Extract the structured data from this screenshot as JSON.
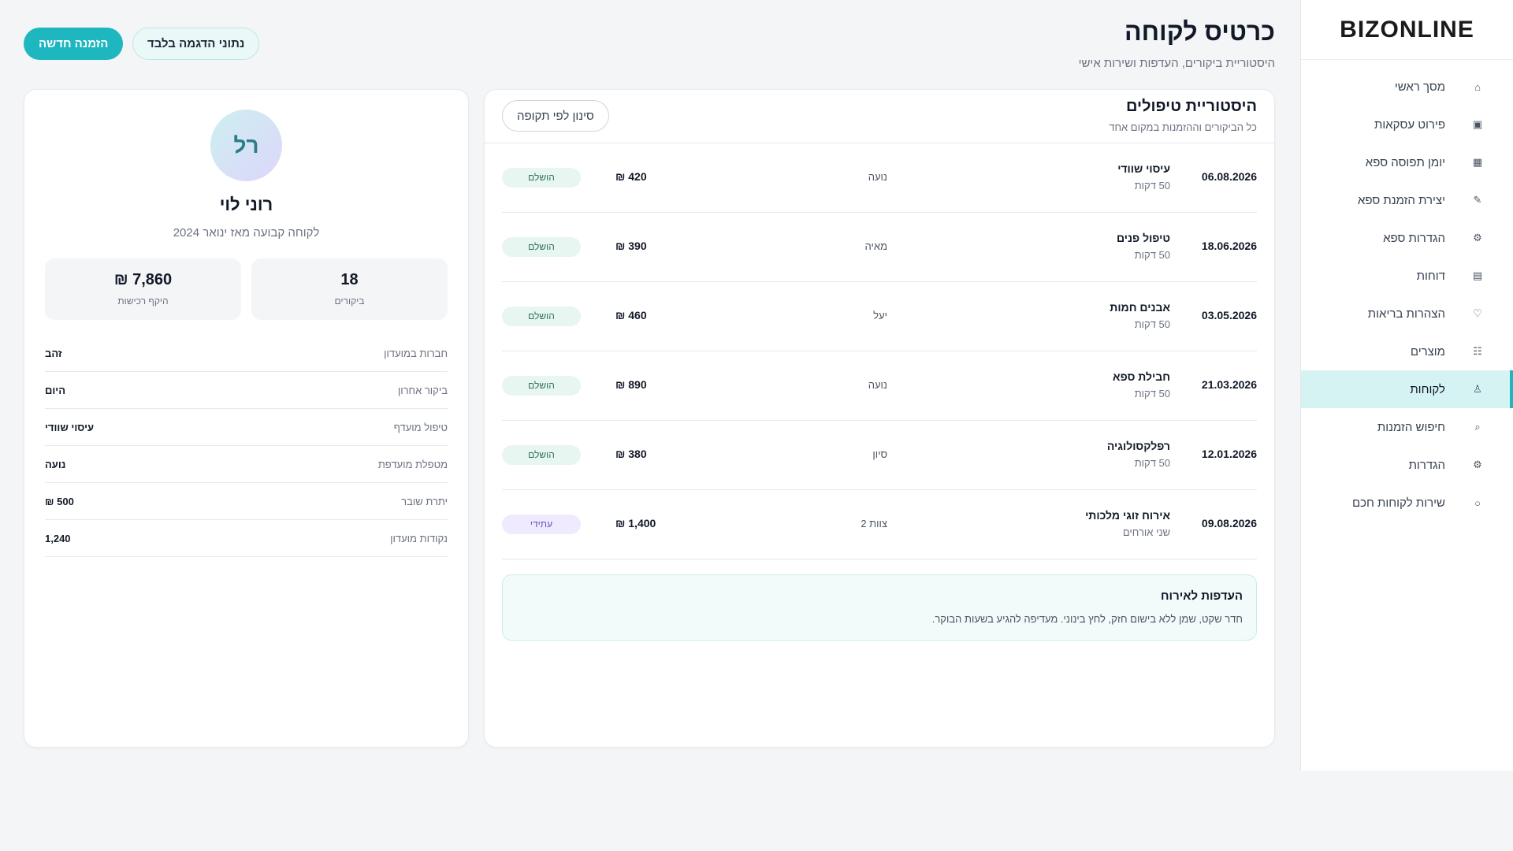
{
  "app": {
    "logo": "BIZONLINE"
  },
  "header": {
    "title": "כרטיס לקוחה",
    "subtitle": "היסטוריית ביקורים, העדפות ושירות אישי",
    "new_booking_label": "הזמנה חדשה",
    "demo_label": "נתוני הדגמה בלבד"
  },
  "sidebar": {
    "items": [
      {
        "label": "מסך ראשי",
        "icon": "home-icon",
        "glyph": "⌂"
      },
      {
        "label": "פירוט עסקאות",
        "icon": "transactions-icon",
        "glyph": "▣"
      },
      {
        "label": "יומן תפוסה ספא",
        "icon": "calendar-icon",
        "glyph": "▦"
      },
      {
        "label": "יצירת הזמנת ספא",
        "icon": "pencil-icon",
        "glyph": "✎"
      },
      {
        "label": "הגדרות ספא",
        "icon": "spa-settings-icon",
        "glyph": "⚙"
      },
      {
        "label": "דוחות",
        "icon": "reports-icon",
        "glyph": "▤"
      },
      {
        "label": "הצהרות בריאות",
        "icon": "heart-icon",
        "glyph": "♡"
      },
      {
        "label": "מוצרים",
        "icon": "products-icon",
        "glyph": "☷"
      },
      {
        "label": "לקוחות",
        "icon": "customers-icon",
        "glyph": "♙"
      },
      {
        "label": "חיפוש הזמנות",
        "icon": "search-icon",
        "glyph": "⌕"
      },
      {
        "label": "הגדרות",
        "icon": "settings-icon",
        "glyph": "⚙"
      },
      {
        "label": "שירות לקוחות חכם",
        "icon": "support-icon",
        "glyph": "○"
      }
    ],
    "active_label": "לקוחות"
  },
  "history": {
    "title": "היסטוריית טיפולים",
    "subtitle": "כל הביקורים וההזמנות במקום אחד",
    "filter_label": "סינון לפי תקופה",
    "rows": [
      {
        "date": "06.08.2026",
        "treatment": "עיסוי שוודי",
        "duration": "50 דקות",
        "therapist": "נועה",
        "price": "420 ₪",
        "status": "הושלם",
        "status_type": "done"
      },
      {
        "date": "18.06.2026",
        "treatment": "טיפול פנים",
        "duration": "50 דקות",
        "therapist": "מאיה",
        "price": "390 ₪",
        "status": "הושלם",
        "status_type": "done"
      },
      {
        "date": "03.05.2026",
        "treatment": "אבנים חמות",
        "duration": "50 דקות",
        "therapist": "יעל",
        "price": "460 ₪",
        "status": "הושלם",
        "status_type": "done"
      },
      {
        "date": "21.03.2026",
        "treatment": "חבילת ספא",
        "duration": "50 דקות",
        "therapist": "נועה",
        "price": "890 ₪",
        "status": "הושלם",
        "status_type": "done"
      },
      {
        "date": "12.01.2026",
        "treatment": "רפלקסולוגיה",
        "duration": "50 דקות",
        "therapist": "סיון",
        "price": "380 ₪",
        "status": "הושלם",
        "status_type": "done"
      },
      {
        "date": "09.08.2026",
        "treatment": "אירוח זוגי מלכותי",
        "duration": "שני אורחים",
        "therapist": "צוות 2",
        "price": "1,400 ₪",
        "status": "עתידי",
        "status_type": "future"
      }
    ],
    "prefs_title": "העדפות לאירוח",
    "prefs_text": "חדר שקט, שמן ללא בישום חזק, לחץ בינוני. מעדיפה להגיע בשעות הבוקר."
  },
  "profile": {
    "initials": "רל",
    "name": "רוני לוי",
    "since": "לקוחה קבועה מאז ינואר 2024",
    "visits_value": "18",
    "visits_label": "ביקורים",
    "spend_value": "7,860 ₪",
    "spend_label": "היקף רכישות",
    "details": [
      {
        "label": "חברות במועדון",
        "value": "זהב"
      },
      {
        "label": "ביקור אחרון",
        "value": "היום"
      },
      {
        "label": "טיפול מועדף",
        "value": "עיסוי שוודי"
      },
      {
        "label": "מטפלת מועדפת",
        "value": "נועה"
      },
      {
        "label": "יתרת שובר",
        "value": "500 ₪"
      },
      {
        "label": "נקודות מועדון",
        "value": "1,240"
      }
    ]
  },
  "colors": {
    "accent": "#1eb7bf",
    "active_nav_bg": "#d6f3f3",
    "done_badge_bg": "#e7f6f1",
    "future_badge_bg": "#efeafd"
  }
}
